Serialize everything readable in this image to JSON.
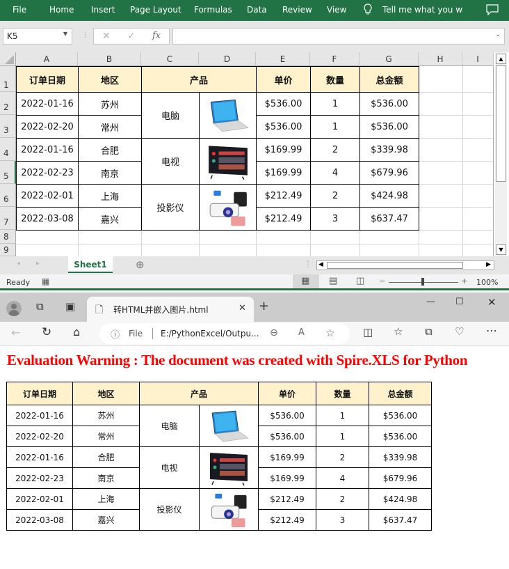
{
  "excel": {
    "ribbon_tabs": [
      "File",
      "Home",
      "Insert",
      "Page Layout",
      "Formulas",
      "Data",
      "Review",
      "View"
    ],
    "tell_me": "Tell me what you want",
    "name_box": "K5",
    "formula": "",
    "columns": [
      "A",
      "B",
      "C",
      "D",
      "E",
      "F",
      "G",
      "H",
      "I"
    ],
    "rows": [
      "1",
      "2",
      "3",
      "4",
      "5",
      "6",
      "7",
      "8",
      "9"
    ],
    "sheet_tab": "Sheet1",
    "status": "Ready",
    "zoom": "100%"
  },
  "table": {
    "headers": {
      "date": "订单日期",
      "region": "地区",
      "product": "产品",
      "price": "单价",
      "qty": "数量",
      "total": "总金额"
    },
    "rows": [
      {
        "date": "2022-01-16",
        "region": "苏州",
        "price": "$536.00",
        "qty": "1",
        "total": "$536.00"
      },
      {
        "date": "2022-02-20",
        "region": "常州",
        "price": "$536.00",
        "qty": "1",
        "total": "$536.00"
      },
      {
        "date": "2022-01-16",
        "region": "合肥",
        "price": "$169.99",
        "qty": "2",
        "total": "$339.98"
      },
      {
        "date": "2022-02-23",
        "region": "南京",
        "price": "$169.99",
        "qty": "4",
        "total": "$679.96"
      },
      {
        "date": "2022-02-01",
        "region": "上海",
        "price": "$212.49",
        "qty": "2",
        "total": "$424.98"
      },
      {
        "date": "2022-03-08",
        "region": "嘉兴",
        "price": "$212.49",
        "qty": "3",
        "total": "$637.47"
      }
    ],
    "products": [
      {
        "name": "电脑",
        "image": "laptop-image"
      },
      {
        "name": "电视",
        "image": "tv-image"
      },
      {
        "name": "投影仪",
        "image": "projector-image"
      }
    ]
  },
  "browser": {
    "tab_title": "转HTML并嵌入图片.html",
    "address_prefix": "File",
    "address": "E:/PythonExcel/Outpu...",
    "warning": "Evaluation Warning : The document was created with  Spire.XLS for Python"
  },
  "colors": {
    "excel_green": "#217346",
    "header_fill": "#fff2cc",
    "warning_red": "#ff0000"
  }
}
